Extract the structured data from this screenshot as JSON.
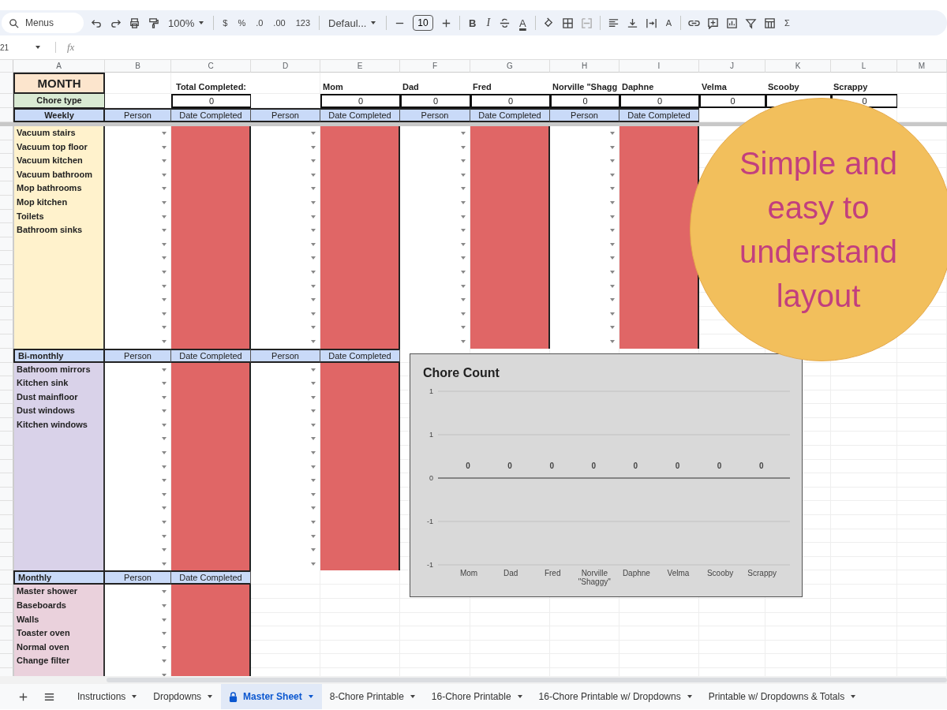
{
  "toolbar": {
    "search": {
      "placeholder": "Menus"
    },
    "zoom": "100%",
    "currency": "$",
    "percent": "%",
    "decrease_decimals": ".0",
    "increase_decimals": ".00",
    "number_format": "123",
    "font": "Defaul...",
    "font_size": "10",
    "bold": "B",
    "italic": "I",
    "text_color": "A",
    "text_rotation": "A",
    "functions": "Σ"
  },
  "formula_bar": {
    "name_box": "21",
    "fx": "fx"
  },
  "column_headers": [
    "A",
    "B",
    "C",
    "D",
    "E",
    "F",
    "G",
    "H",
    "I",
    "J",
    "K",
    "L",
    "M"
  ],
  "header": {
    "month": "MONTH",
    "chore_type": "Chore type",
    "total_label": "Total Completed:",
    "total": "0",
    "people": [
      {
        "name": "Mom",
        "total": "0"
      },
      {
        "name": "Dad",
        "total": "0"
      },
      {
        "name": "Fred",
        "total": "0"
      },
      {
        "name": "Norville \"Shagg",
        "total": "0"
      },
      {
        "name": "Daphne",
        "total": "0"
      },
      {
        "name": "Velma",
        "total": "0"
      },
      {
        "name": "Scooby"
      },
      {
        "name": "Scrappy",
        "total": "0"
      }
    ]
  },
  "sections": [
    {
      "kind": "weekly",
      "label": "Weekly",
      "column_headers": [
        "Person",
        "Date Completed",
        "Person",
        "Date Completed",
        "Person",
        "Date Completed",
        "Person",
        "Date Completed"
      ],
      "chores": [
        "Vacuum stairs",
        "Vacuum top floor",
        "Vacuum kitchen",
        "Vacuum bathroom",
        "Mop bathrooms",
        "Mop kitchen",
        "Toilets",
        "Bathroom sinks"
      ]
    },
    {
      "kind": "bi-monthly",
      "label": "Bi-monthly",
      "column_headers": [
        "Person",
        "Date Completed",
        "Person",
        "Date Completed"
      ],
      "chores": [
        "Bathroom mirrors",
        "Kitchen sink",
        "Dust mainfloor",
        "Dust windows",
        "Kitchen windows"
      ]
    },
    {
      "kind": "monthly",
      "label": "Monthly",
      "column_headers": [
        "Person",
        "Date Completed"
      ],
      "chores": [
        "Master shower",
        "Baseboards",
        "Walls",
        "Toaster oven",
        "Normal oven",
        "Change filter"
      ]
    }
  ],
  "chart": {
    "chart_data": {
      "type": "bar",
      "title": "Chore Count",
      "categories": [
        "Mom",
        "Dad",
        "Fred",
        "Norville \"Shaggy\"",
        "Daphne",
        "Velma",
        "Scooby",
        "Scrappy"
      ],
      "values": [
        0,
        0,
        0,
        0,
        0,
        0,
        0,
        0
      ],
      "ylim": [
        -1,
        1
      ],
      "yticks": [
        {
          "value": 1,
          "label": "1"
        },
        {
          "value": 0.5,
          "label": "1"
        },
        0,
        {
          "value": -0.5,
          "label": "-1"
        },
        {
          "value": -1,
          "label": "-1"
        }
      ],
      "data_labels": true
    }
  },
  "promo_badge": {
    "text": "Simple and easy to understand layout"
  },
  "sheet_tabs": [
    {
      "label": "Instructions",
      "selected": false,
      "locked": false
    },
    {
      "label": "Dropdowns",
      "selected": false,
      "locked": false
    },
    {
      "label": "Master Sheet",
      "selected": true,
      "locked": true
    },
    {
      "label": "8-Chore Printable",
      "selected": false,
      "locked": false
    },
    {
      "label": "16-Chore Printable",
      "selected": false,
      "locked": false
    },
    {
      "label": "16-Chore Printable w/ Dropdowns",
      "selected": false,
      "locked": false
    },
    {
      "label": "Printable w/ Dropdowns & Totals",
      "selected": false,
      "locked": false
    }
  ]
}
